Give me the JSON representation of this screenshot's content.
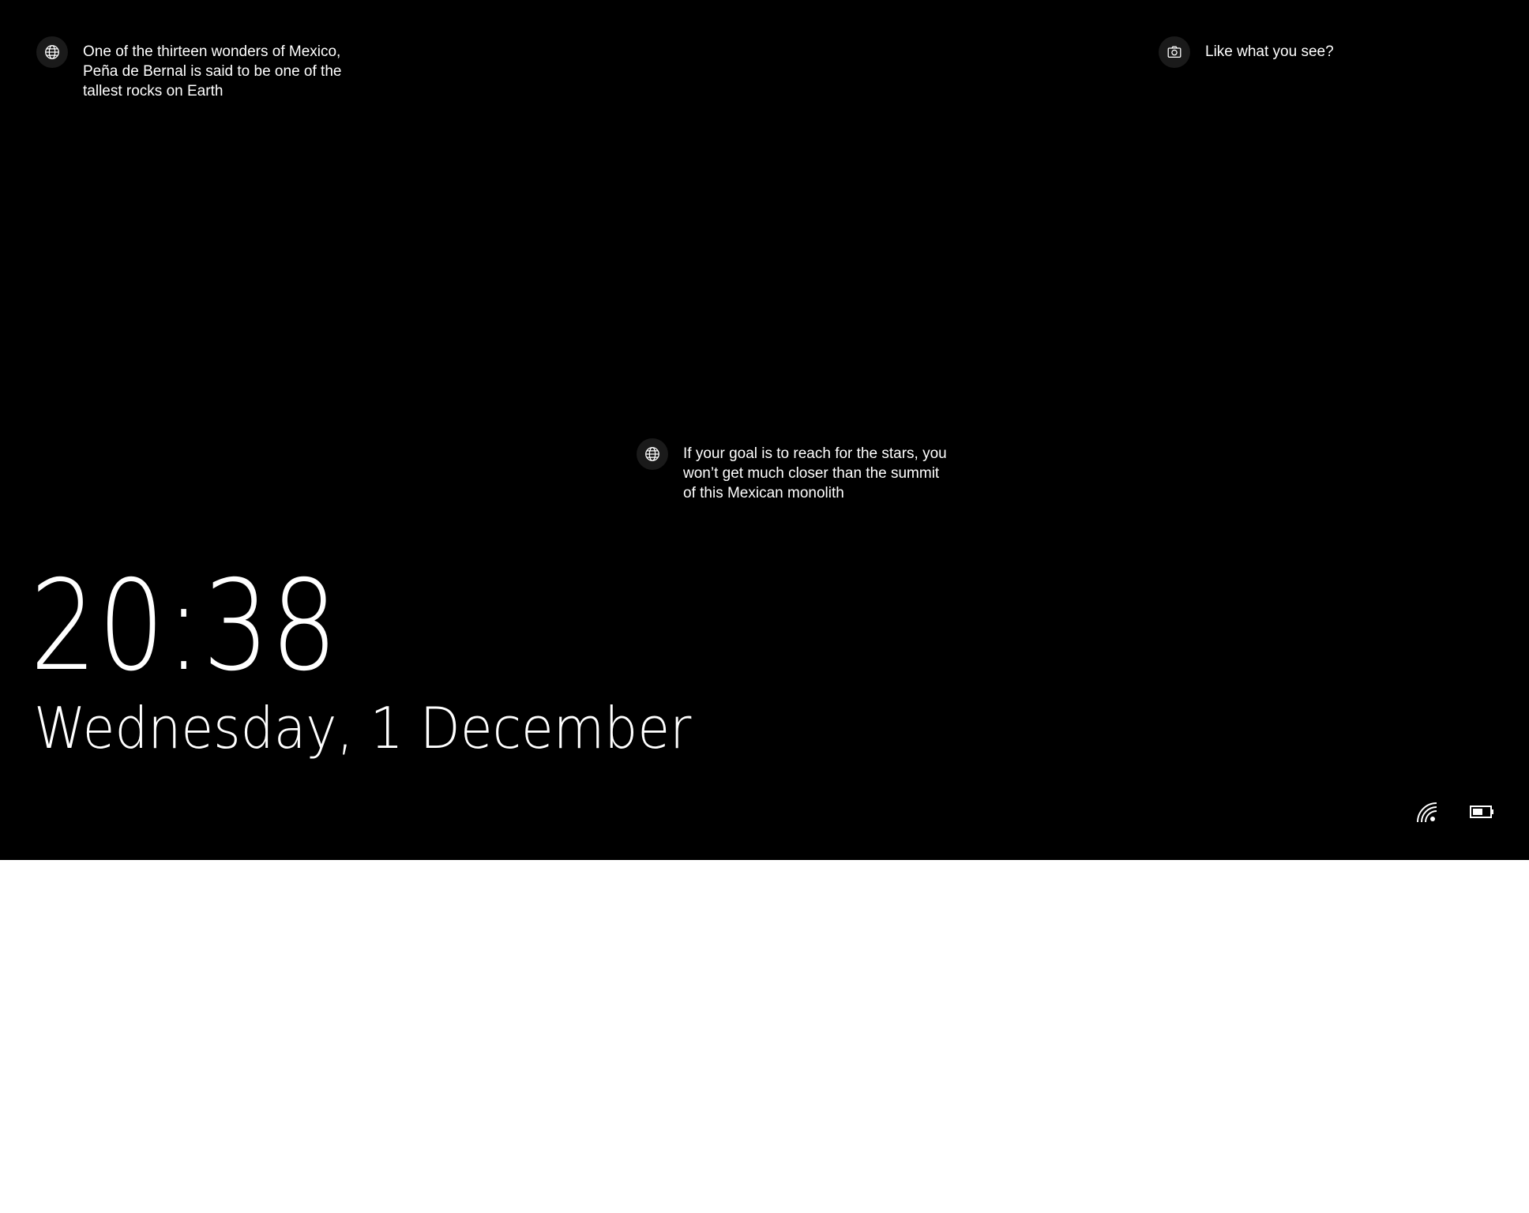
{
  "hotspots": [
    {
      "icon": "globe-icon",
      "text": "One of the thirteen wonders of Mexico,\nPeña de Bernal is said to be one of the\ntallest rocks on Earth"
    },
    {
      "icon": "globe-icon",
      "text": "If your goal is to reach for the stars, you\nwon’t get much closer than the summit\nof this Mexican monolith"
    }
  ],
  "camera_hotspot": {
    "icon": "camera-icon",
    "text": "Like what you see?"
  },
  "clock": {
    "time": "20:38",
    "date": "Wednesday, 1 December"
  },
  "status": {
    "network_icon": "wifi-icon",
    "battery_icon": "battery-icon"
  },
  "colors": {
    "background": "#000000",
    "text": "#ffffff",
    "icon_circle": "#1a1a1a"
  }
}
